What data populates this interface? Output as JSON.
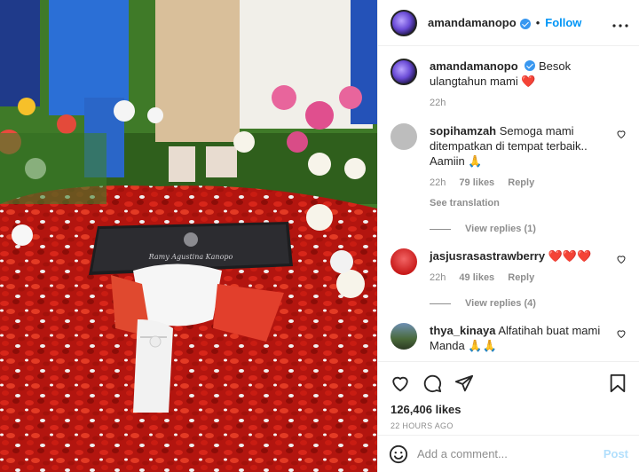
{
  "post": {
    "username": "amandamanopo",
    "follow_label": "Follow",
    "more_label": "•••",
    "caption": "Besok ulangtahun mami",
    "caption_emoji": "❤️",
    "caption_time": "22h"
  },
  "comments": [
    {
      "username": "sopihamzah",
      "text": "Semoga mami ditempatkan di tempat terbaik.. Aamiin",
      "emoji": "🙏",
      "time": "22h",
      "likes": "79 likes",
      "reply": "Reply",
      "see_translation": "See translation",
      "view_replies": "View replies (1)"
    },
    {
      "username": "jasjusrasastrawberry",
      "text": "",
      "emoji": "❤️❤️❤️",
      "time": "22h",
      "likes": "49 likes",
      "reply": "Reply",
      "view_replies": "View replies (4)"
    },
    {
      "username": "thya_kinaya",
      "text": "Alfatihah buat mami Manda",
      "emoji": "🙏🙏"
    }
  ],
  "footer": {
    "likes": "126,406 likes",
    "time_ago": "22 HOURS AGO",
    "comment_placeholder": "Add a comment...",
    "post_label": "Post"
  },
  "photo": {
    "plaque_name": "Ramy Agustina Kanopo"
  },
  "colors": {
    "link": "#0095f6",
    "petals": "#c81a12",
    "grass": "#3f7a28"
  },
  "icons": [
    "heart-icon",
    "comment-icon",
    "share-icon",
    "bookmark-icon",
    "emoji-icon",
    "more-options-icon",
    "verified-badge-icon"
  ]
}
